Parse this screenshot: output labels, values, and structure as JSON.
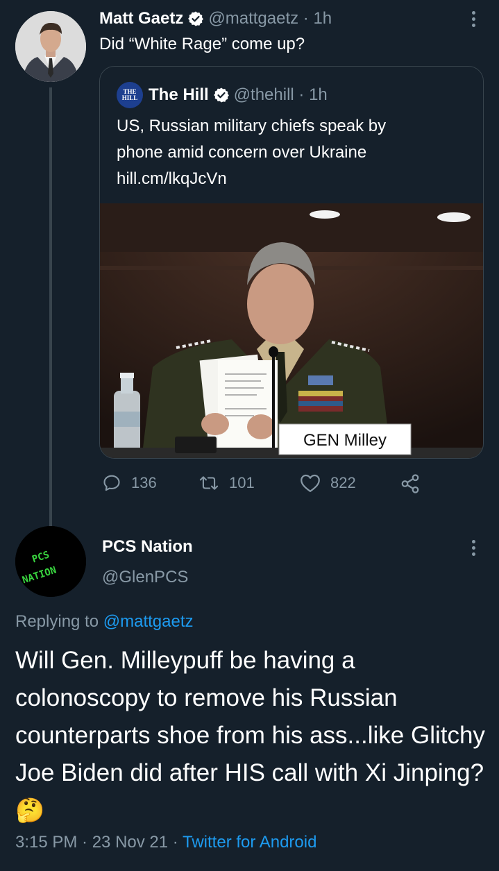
{
  "tweet1": {
    "name": "Matt Gaetz",
    "handle_time": "@mattgaetz · 1h",
    "text": "Did “White Rage” come up?",
    "quote": {
      "logo_text": "THE HILL",
      "name": "The Hill",
      "handle_time": "@thehill · 1h",
      "text_lines": [
        "US, Russian military chiefs speak by",
        "phone amid concern over Ukraine",
        "hill.cm/lkqJcVn"
      ],
      "photo_sign": "GEN Milley"
    },
    "actions": {
      "replies": "136",
      "retweets": "101",
      "likes": "822"
    }
  },
  "tweet2": {
    "name": "PCS Nation",
    "handle": "@GlenPCS",
    "avatar_text": "PCS NATION",
    "replying_prefix": "Replying to ",
    "replying_handle": "@mattgaetz",
    "text": "Will Gen. Milleypuff be having a colonoscopy to remove his Russian counterparts shoe from his ass...like Glitchy Joe Biden did after HIS call with Xi Jinping?",
    "emoji": "🤔",
    "time_date": "3:15 PM · 23 Nov 21 · ",
    "source": "Twitter for Android"
  },
  "colors": {
    "background": "#15202b",
    "secondary_text": "#8899a6",
    "link": "#1d9bf0",
    "verified": "#ffffff"
  }
}
